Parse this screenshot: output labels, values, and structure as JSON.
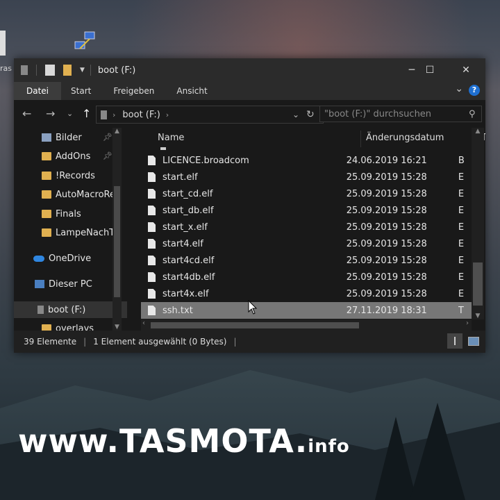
{
  "window": {
    "title": "boot (F:)",
    "controls": {
      "minimize": "─",
      "maximize": "☐",
      "close": "✕"
    }
  },
  "ribbon": {
    "tabs": [
      "Datei",
      "Start",
      "Freigeben",
      "Ansicht"
    ],
    "help": "?"
  },
  "address": {
    "path": "boot (F:)",
    "search_placeholder": "\"boot (F:)\" durchsuchen"
  },
  "nav": {
    "items": [
      {
        "label": "Bilder",
        "icon": "pictures-icon",
        "pinned": true
      },
      {
        "label": "AddOns",
        "icon": "folder-icon",
        "pinned": true
      },
      {
        "label": "!Records",
        "icon": "folder-icon",
        "pinned": false
      },
      {
        "label": "AutoMacroRec",
        "icon": "folder-icon",
        "pinned": false
      },
      {
        "label": "Finals",
        "icon": "folder-icon",
        "pinned": false
      },
      {
        "label": "LampeNachTag",
        "icon": "folder-icon",
        "pinned": false
      },
      {
        "label": "OneDrive",
        "icon": "cloud-icon",
        "pinned": false
      },
      {
        "label": "Dieser PC",
        "icon": "pc-icon",
        "pinned": false
      },
      {
        "label": "boot (F:)",
        "icon": "drive-icon",
        "pinned": false
      },
      {
        "label": "overlays",
        "icon": "folder-icon",
        "pinned": false
      }
    ]
  },
  "columns": {
    "name": "Name",
    "date": "Änderungsdatum",
    "type": "T"
  },
  "files": [
    {
      "name": "LICENCE.broadcom",
      "date": "24.06.2019 16:21",
      "type": "B"
    },
    {
      "name": "start.elf",
      "date": "25.09.2019 15:28",
      "type": "E"
    },
    {
      "name": "start_cd.elf",
      "date": "25.09.2019 15:28",
      "type": "E"
    },
    {
      "name": "start_db.elf",
      "date": "25.09.2019 15:28",
      "type": "E"
    },
    {
      "name": "start_x.elf",
      "date": "25.09.2019 15:28",
      "type": "E"
    },
    {
      "name": "start4.elf",
      "date": "25.09.2019 15:28",
      "type": "E"
    },
    {
      "name": "start4cd.elf",
      "date": "25.09.2019 15:28",
      "type": "E"
    },
    {
      "name": "start4db.elf",
      "date": "25.09.2019 15:28",
      "type": "E"
    },
    {
      "name": "start4x.elf",
      "date": "25.09.2019 15:28",
      "type": "E"
    },
    {
      "name": "ssh.txt",
      "date": "27.11.2019 18:31",
      "type": "T"
    }
  ],
  "status": {
    "count": "39 Elemente",
    "selection": "1 Element ausgewählt (0 Bytes)"
  },
  "desktop_icon_label": "ras",
  "brand": {
    "main": "www.TASMOTA.",
    "suffix": "info"
  }
}
